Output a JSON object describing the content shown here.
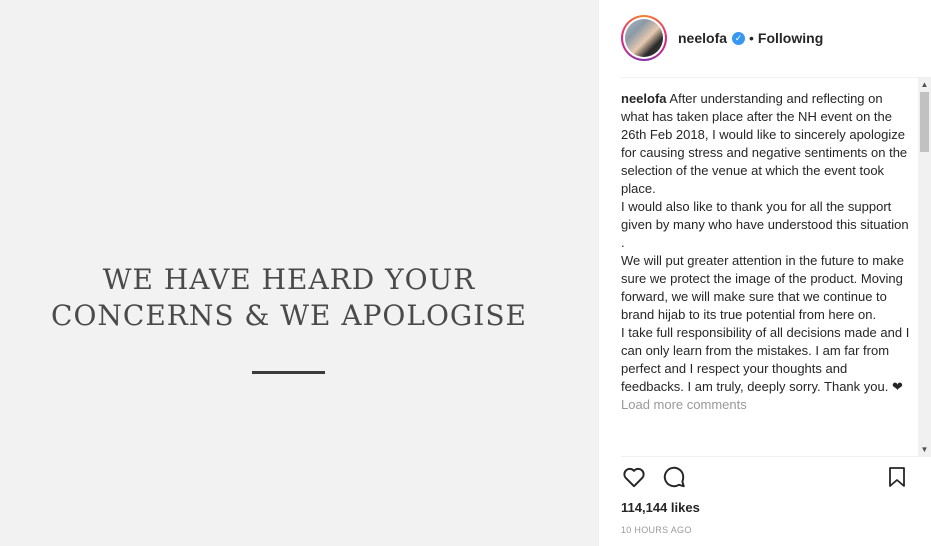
{
  "image": {
    "headline_line1": "WE HAVE HEARD YOUR",
    "headline_line2": "CONCERNS & WE APOLOGISE"
  },
  "post": {
    "username": "neelofa",
    "verified_icon": "verified-badge-icon",
    "separator": "•",
    "follow_status": "Following",
    "caption_username": "neelofa",
    "caption_text": " After understanding and reflecting on what has taken place after the NH event on the 26th Feb 2018, I would like to sincerely apologize for causing stress and negative sentiments on the selection of the venue at which the event took place.\nI would also like to thank you for all the support given by many who have understood this situation .\nWe will put greater attention in the future to make sure we protect the image of the product. Moving forward, we will make sure that we continue to brand hijab to its true potential from here on.\nI take full responsibility of all decisions made and I can only learn from the mistakes. I am far from perfect and I respect your thoughts and feedbacks. I am truly, deeply sorry. Thank you. ❤",
    "load_more": "Load more comments",
    "likes": "114,144 likes",
    "timestamp": "10 HOURS AGO"
  },
  "icons": {
    "like": "heart-icon",
    "comment": "comment-icon",
    "save": "bookmark-icon"
  },
  "colors": {
    "accent": "#3897f0",
    "image_bg": "#f2f2f2"
  }
}
